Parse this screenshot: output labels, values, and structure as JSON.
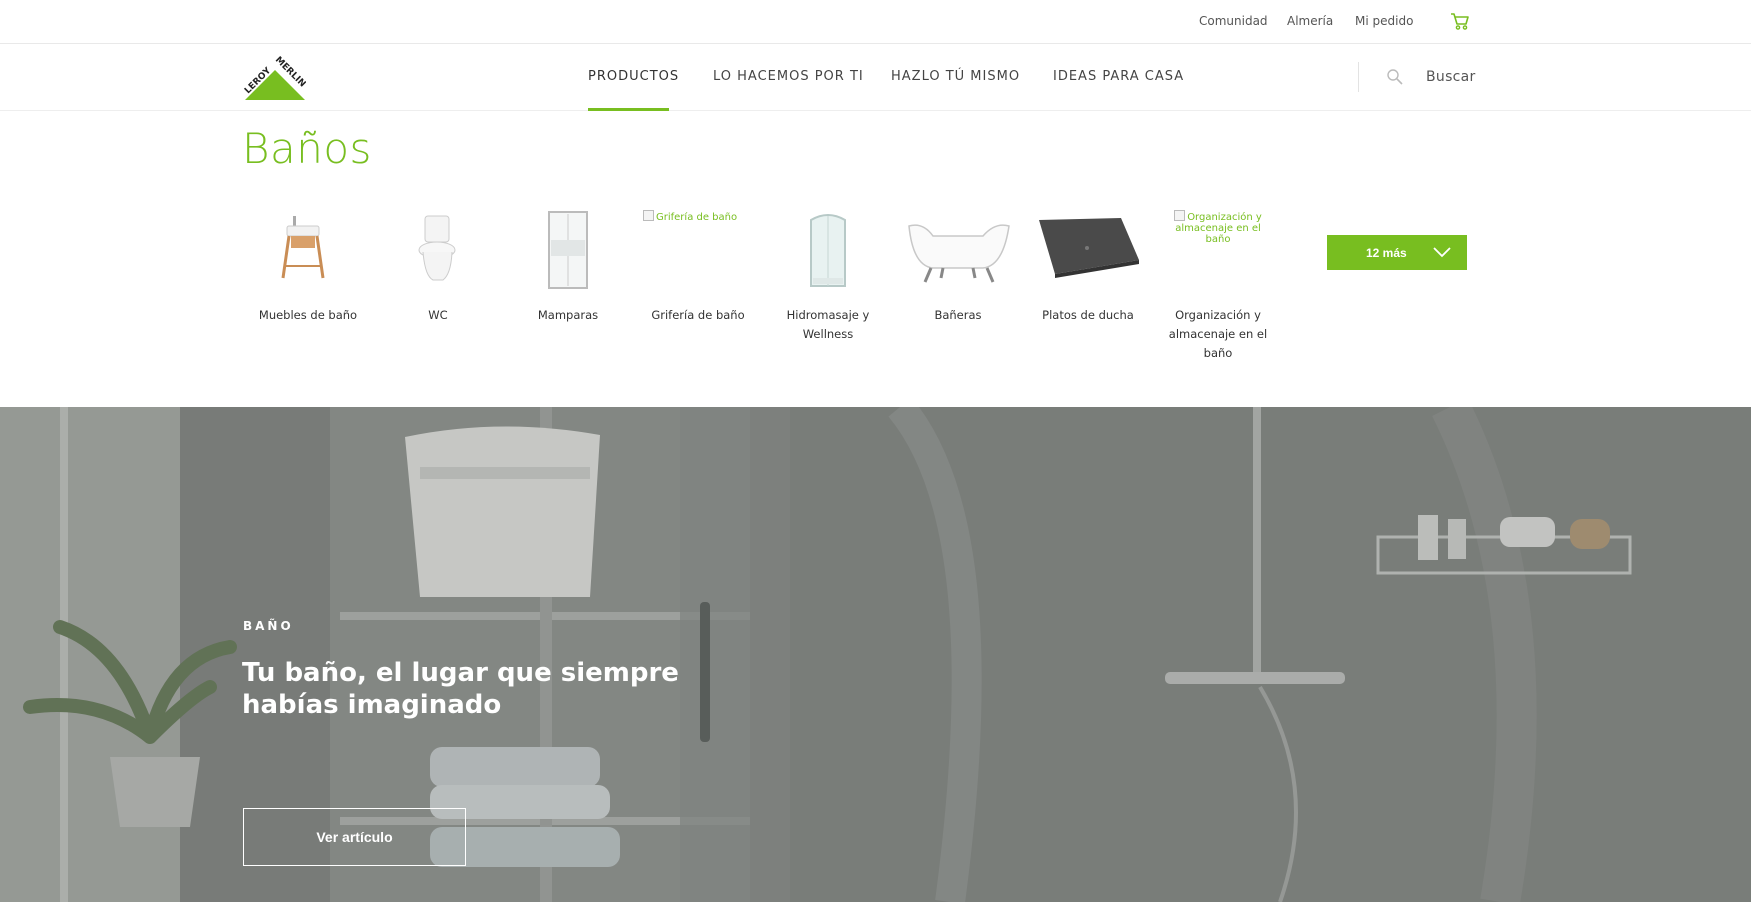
{
  "topbar": {
    "links": [
      "Comunidad",
      "Almería",
      "Mi pedido"
    ]
  },
  "brand": {
    "logo_text": "LEROY MERLIN",
    "accent": "#78be20"
  },
  "nav": {
    "items": [
      "PRODUCTOS",
      "LO HACEMOS POR TI",
      "HAZLO TÚ MISMO",
      "IDEAS PARA CASA"
    ],
    "active": "PRODUCTOS",
    "search_label": "Buscar"
  },
  "page": {
    "title": "Baños"
  },
  "categories": [
    {
      "label": "Muebles de baño",
      "icon": "vanity-unit"
    },
    {
      "label": "WC",
      "icon": "toilet"
    },
    {
      "label": "Mamparas",
      "icon": "shower-screen"
    },
    {
      "label": "Grifería de baño",
      "icon": "broken-image",
      "alt": "Grifería de baño"
    },
    {
      "label": "Hidromasaje y Wellness",
      "icon": "shower-cabin"
    },
    {
      "label": "Bañeras",
      "icon": "bathtub"
    },
    {
      "label": "Platos de ducha",
      "icon": "shower-tray"
    },
    {
      "label": "Organización y almacenaje en el baño",
      "icon": "broken-image",
      "alt": "Organización y almacenaje en el baño"
    }
  ],
  "more_button": {
    "label": "12 más"
  },
  "hero": {
    "kicker": "BAÑO",
    "title": "Tu baño, el lugar que siempre habías imaginado",
    "button": "Ver artículo"
  }
}
